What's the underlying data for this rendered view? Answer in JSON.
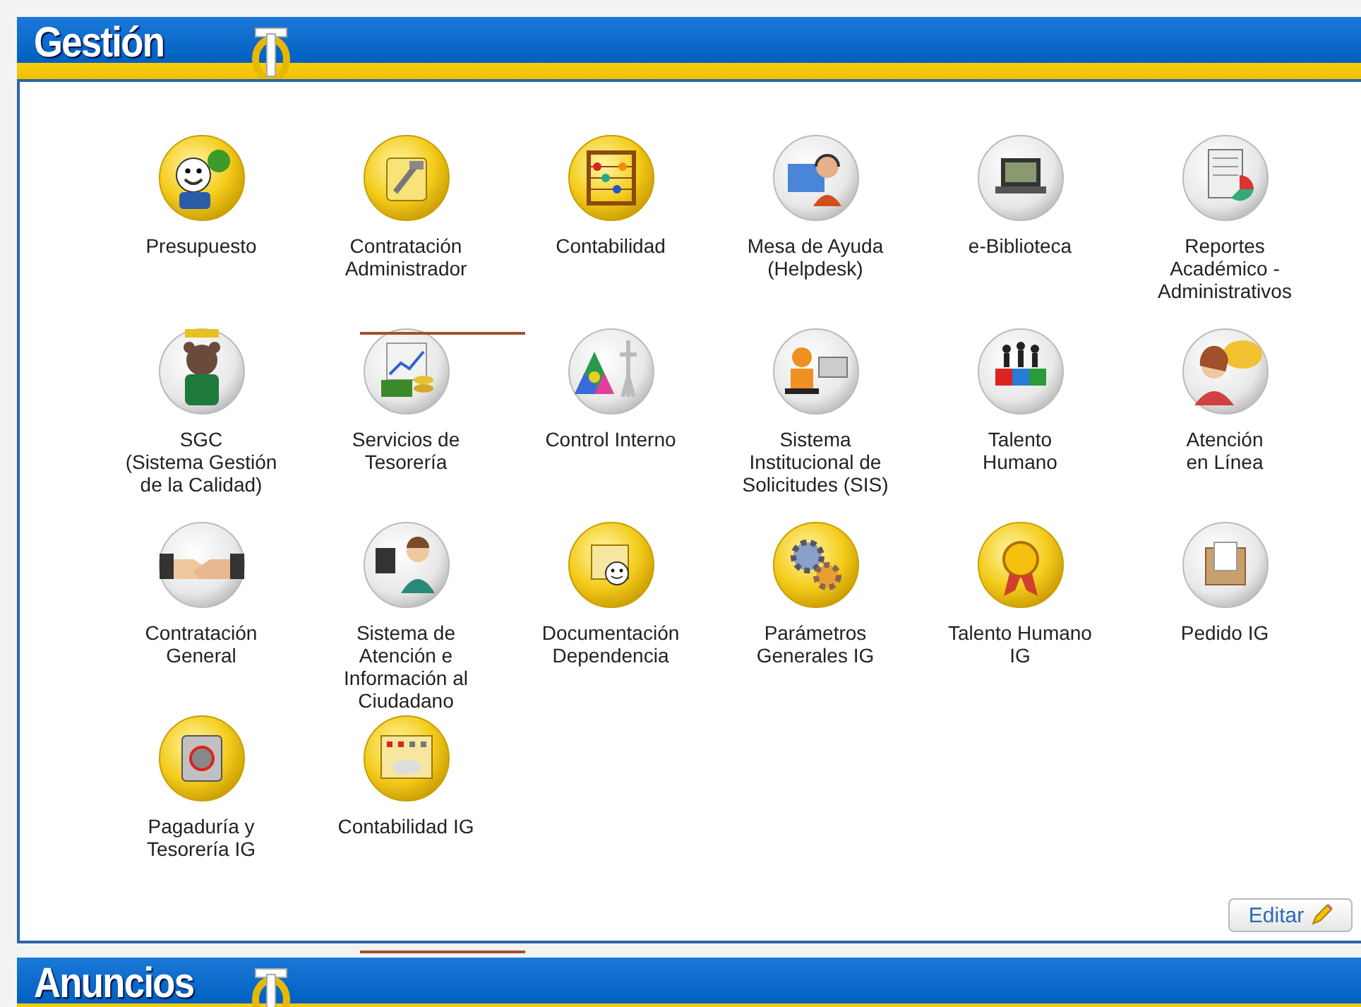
{
  "sections": [
    {
      "title": "Gestión",
      "apps": [
        {
          "label": "Presupuesto"
        },
        {
          "label": "Contratación\nAdministrador"
        },
        {
          "label": "Contabilidad"
        },
        {
          "label": "Mesa de Ayuda\n(Helpdesk)"
        },
        {
          "label": "e-Biblioteca"
        },
        {
          "label": "Reportes\nAcadémico -\nAdministrativos"
        },
        {
          "label": "SGC\n(Sistema Gestión\nde la Calidad)"
        },
        {
          "label": "Servicios de\nTesorería"
        },
        {
          "label": "Control Interno"
        },
        {
          "label": "Sistema\nInstitucional de\nSolicitudes (SIS)"
        },
        {
          "label": "Talento\nHumano"
        },
        {
          "label": "Atención\nen Línea"
        },
        {
          "label": "Contratación\nGeneral"
        },
        {
          "label": "Sistema de\nAtención e\nInformación al\nCiudadano"
        },
        {
          "label": "Documentación\nDependencia"
        },
        {
          "label": "Parámetros\nGenerales IG"
        },
        {
          "label": "Talento Humano\nIG"
        },
        {
          "label": "Pedido IG"
        },
        {
          "label": "Pagaduría y\nTesorería IG"
        },
        {
          "label": "Contabilidad IG"
        }
      ],
      "edit_button": "Editar"
    },
    {
      "title": "Anuncios"
    }
  ]
}
